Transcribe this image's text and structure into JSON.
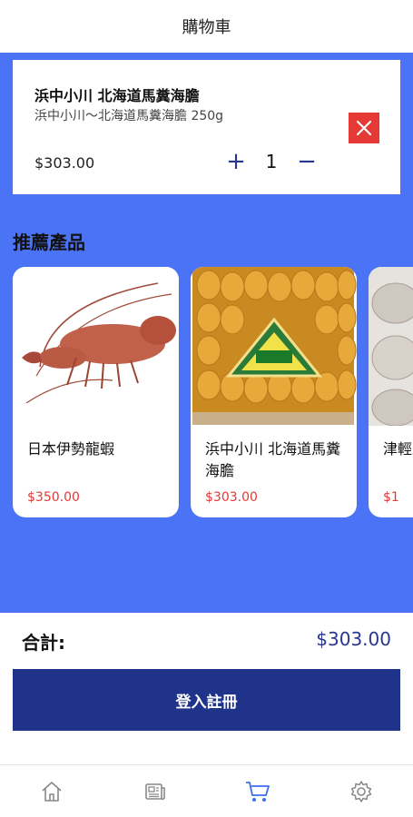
{
  "header": {
    "title": "購物車"
  },
  "cart": {
    "item": {
      "name": "浜中小川 北海道馬糞海膽",
      "description": "浜中小川～北海道馬糞海膽 250g",
      "price": "$303.00",
      "quantity": "1",
      "plus_label": "+",
      "minus_label": "−"
    }
  },
  "recommended": {
    "title": "推薦產品",
    "products": [
      {
        "name": "日本伊勢龍蝦",
        "price": "$350.00"
      },
      {
        "name": "浜中小川 北海道馬糞海膽",
        "price": "$303.00"
      },
      {
        "name": "津輕螺",
        "price": "$1"
      }
    ]
  },
  "summary": {
    "label": "合計:",
    "total": "$303.00"
  },
  "actions": {
    "login_label": "登入註冊"
  },
  "tabbar": {
    "items": [
      "home-icon",
      "news-icon",
      "cart-icon",
      "settings-icon"
    ],
    "active": "cart-icon"
  },
  "colors": {
    "primary": "#4a73f5",
    "dark_blue": "#1f338a",
    "accent_red": "#e53935"
  }
}
